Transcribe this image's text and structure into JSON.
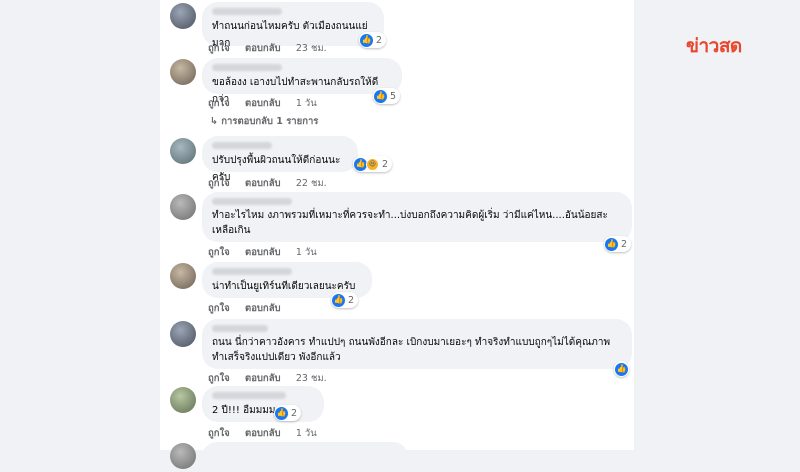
{
  "brand": {
    "watermark": "ข่าวสด",
    "accent": "#e8472e"
  },
  "colors": {
    "like_blue": "#1877f2",
    "bubble_bg": "#f0f2f5",
    "meta_gray": "#65676b"
  },
  "actions": {
    "like_label": "ถูกใจ",
    "reply_label": "ตอบกลับ"
  },
  "comments": [
    {
      "text": "ทำถนนก่อนไหมครับ ตัวเมืองถนนแย่มาก",
      "time": "23 ชม.",
      "reaction_count": "2",
      "reactions": [
        "like-icon"
      ]
    },
    {
      "text": "ขอล้องง เอางบไปทำสะพานกลับรถให้ดีกว่า",
      "time": "1 วัน",
      "reaction_count": "5",
      "reactions": [
        "like-icon"
      ],
      "replies": "↳ การตอบกลับ 1 รายการ"
    },
    {
      "text": "ปรับปรุงพื้นผิวถนนให้ดีก่อนนะครับ",
      "time": "22 ชม.",
      "reaction_count": "2",
      "reactions": [
        "like-icon",
        "haha-icon"
      ]
    },
    {
      "text": "ทำอะไรไหม งภาพรวมที่เหมาะที่ควรจะทำ...บ่งบอกถึงความคิดผู้เริ่ม ว่ามีแค่ไหน....อันน้อยสะเหลือเกิน",
      "time": "1 วัน",
      "reaction_count": "2",
      "reactions": [
        "like-icon"
      ]
    },
    {
      "text": "น่าทำเป็นยูเทิร์นทีเดียวเลยนะครับ",
      "time": "",
      "reaction_count": "2",
      "reactions": [
        "like-icon"
      ]
    },
    {
      "text": "ถนน นี่กว่าคาวอังคาร ทำแปปๆ ถนนพังอีกละ เบิกงบมาเยอะๆ ทำจริงทำแบบถูกๆไม่ได้คุณภาพ ทำเสร็จริงแปปเดียว พังอีกแล้ว",
      "time": "23 ชม.",
      "reaction_count": "",
      "reactions": [
        "like-icon"
      ]
    },
    {
      "text": "2 ปี!!! อืมมมม",
      "time": "1 วัน",
      "reaction_count": "2",
      "reactions": [
        "like-icon"
      ]
    }
  ]
}
